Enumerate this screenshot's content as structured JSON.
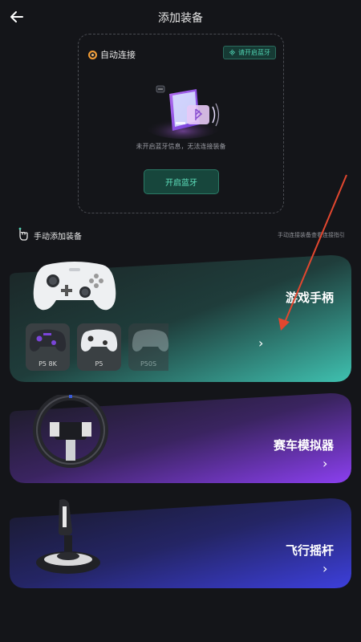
{
  "header": {
    "title": "添加装备"
  },
  "auto_connect": {
    "label": "自动连接",
    "bt_chip": "请开启蓝牙",
    "warning": "未开启蓝牙信息，无法连接装备",
    "open_button": "开启蓝牙"
  },
  "manual": {
    "label": "手动添加装备",
    "guide": "手动连接装备查看连接指引"
  },
  "categories": [
    {
      "title": "游戏手柄",
      "arrow": "›"
    },
    {
      "title": "赛车模拟器",
      "arrow": "›"
    },
    {
      "title": "飞行摇杆",
      "arrow": "›"
    }
  ],
  "gamepad_models": [
    {
      "label": "P5 8K"
    },
    {
      "label": "P5"
    },
    {
      "label": "P50S"
    }
  ],
  "colors": {
    "accent_teal": "#4fd1b1",
    "annotation_red": "#e2472f",
    "gamepad_gradient": "#3fc1b0",
    "race_gradient": "#8b3ff0",
    "flight_gradient": "#3d3fdc"
  }
}
